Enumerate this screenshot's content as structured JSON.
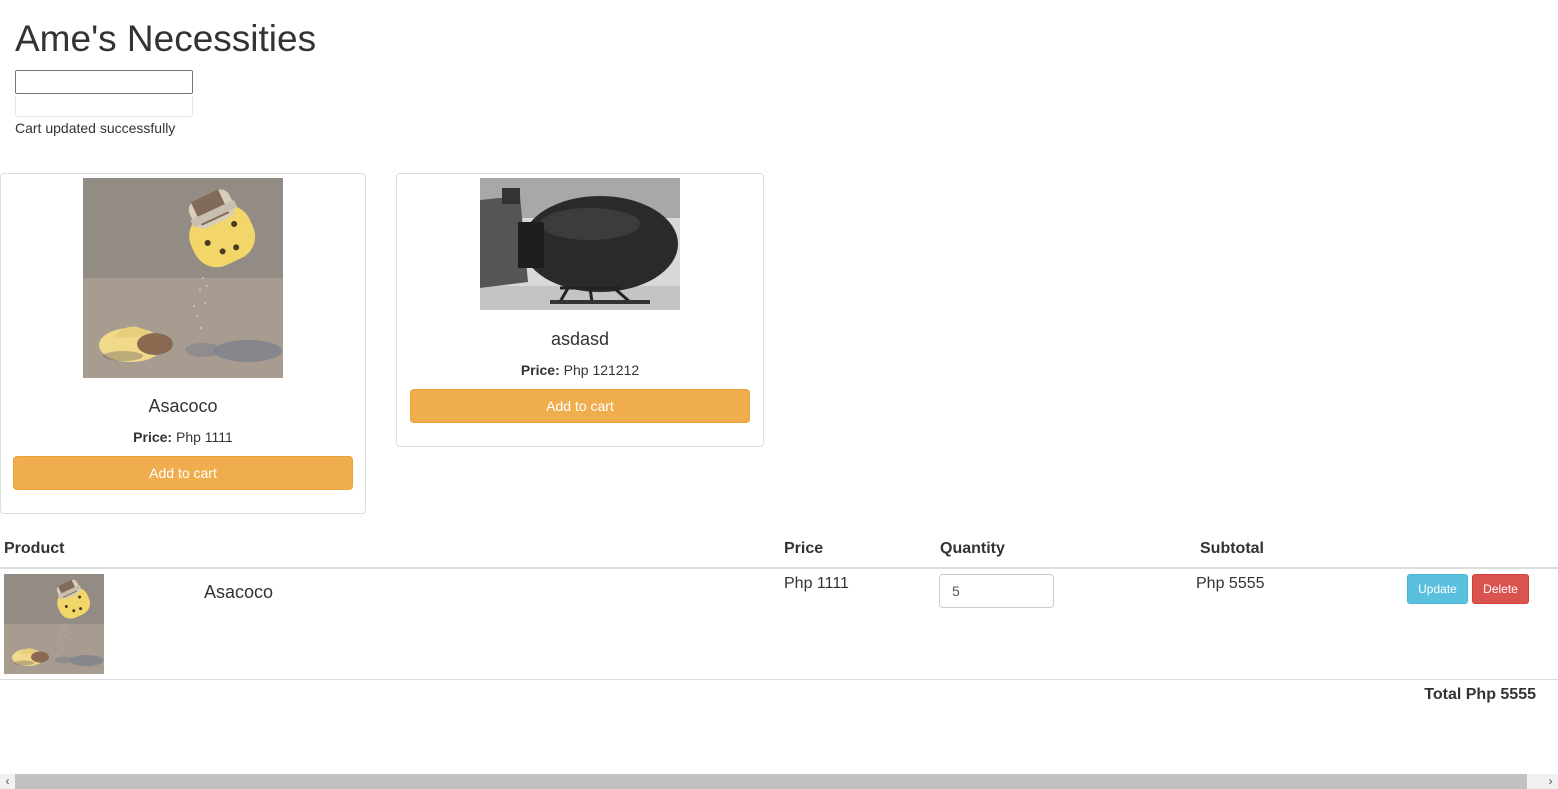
{
  "header": {
    "title": "Ame's Necessities",
    "search_value": "",
    "status": "Cart updated successfully"
  },
  "products": [
    {
      "name": "Asacoco",
      "price_label": "Price:",
      "price_value": "Php 1111",
      "button": "Add to cart",
      "image": "yellow-capsule-salt-shaker-photo"
    },
    {
      "name": "asdasd",
      "price_label": "Price:",
      "price_value": "Php 121212",
      "button": "Add to cart",
      "image": "black-bomb-photo"
    }
  ],
  "cart": {
    "headers": {
      "product": "Product",
      "price": "Price",
      "quantity": "Quantity",
      "subtotal": "Subtotal"
    },
    "rows": [
      {
        "name": "Asacoco",
        "price": "Php 1111",
        "quantity": "5",
        "subtotal": "Php 5555",
        "update": "Update",
        "delete": "Delete",
        "image": "yellow-capsule-salt-shaker-photo"
      }
    ],
    "total": "Total Php 5555"
  },
  "scrollbar": {
    "left_arrow": "‹",
    "right_arrow": "›"
  },
  "colors": {
    "warning": "#f0ad4e",
    "info": "#5bc0de",
    "danger": "#d9534f"
  }
}
